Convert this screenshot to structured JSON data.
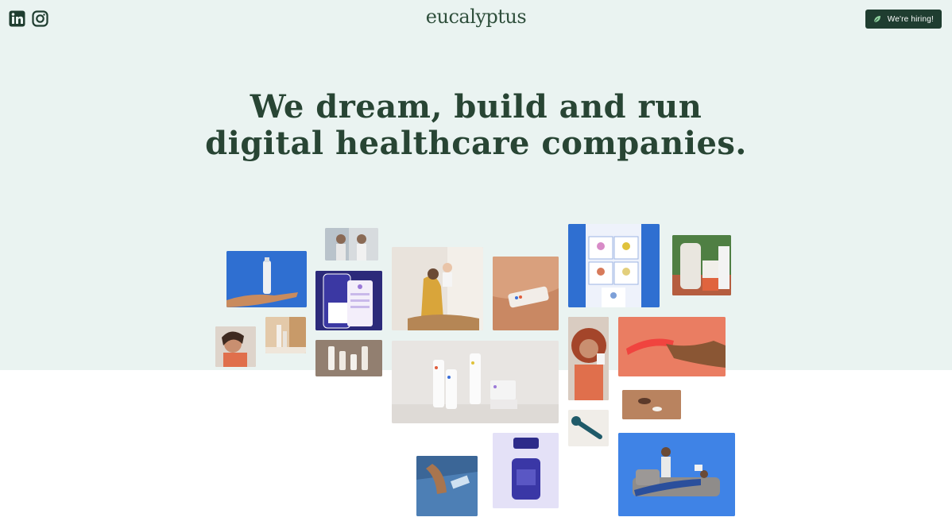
{
  "header": {
    "logo_text": "eucalyptus",
    "hiring_label": "We're hiring!"
  },
  "social": {
    "linkedin_icon": "linkedin-icon",
    "instagram_icon": "instagram-icon"
  },
  "hero": {
    "line1": "We dream, build and run",
    "line2": "digital healthcare companies."
  },
  "colors": {
    "hero_bg": "#eaf3f1",
    "text_green": "#284534",
    "button_bg": "#1f3d30",
    "logo_accent": "#b24a3a"
  }
}
